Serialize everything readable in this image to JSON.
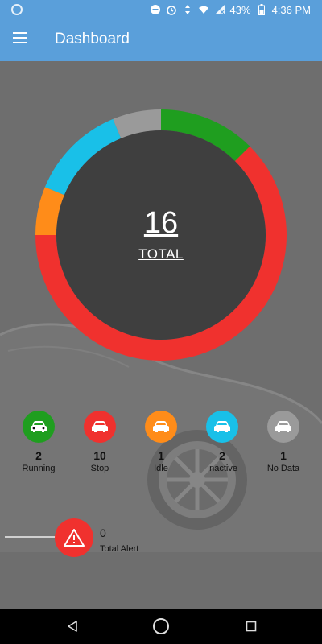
{
  "status_bar": {
    "battery": "43%",
    "time": "4:36 PM"
  },
  "app_bar": {
    "title": "Dashboard"
  },
  "summary": {
    "total_value": "16",
    "total_label": "TOTAL"
  },
  "chart_data": {
    "type": "pie",
    "categories": [
      "Running",
      "Stop",
      "Idle",
      "Inactive",
      "No Data"
    ],
    "values": [
      2,
      10,
      1,
      2,
      1
    ],
    "colors": [
      "#1f9e1f",
      "#f0312e",
      "#ff8c19",
      "#19c0e8",
      "#9a9a9a"
    ],
    "start_category": "Running",
    "start_angle_deg": 0,
    "direction": "clockwise"
  },
  "stats": [
    {
      "count": "2",
      "label": "Running",
      "color": "#1f9e1f",
      "icon": "car-icon"
    },
    {
      "count": "10",
      "label": "Stop",
      "color": "#f0312e",
      "icon": "car-icon"
    },
    {
      "count": "1",
      "label": "Idle",
      "color": "#ff8c19",
      "icon": "car-icon"
    },
    {
      "count": "2",
      "label": "Inactive",
      "color": "#19c0e8",
      "icon": "car-icon"
    },
    {
      "count": "1",
      "label": "No Data",
      "color": "#9a9a9a",
      "icon": "car-icon"
    }
  ],
  "alert": {
    "count": "0",
    "label": "Total Alert",
    "color": "#f0312e",
    "icon": "warning-icon"
  }
}
